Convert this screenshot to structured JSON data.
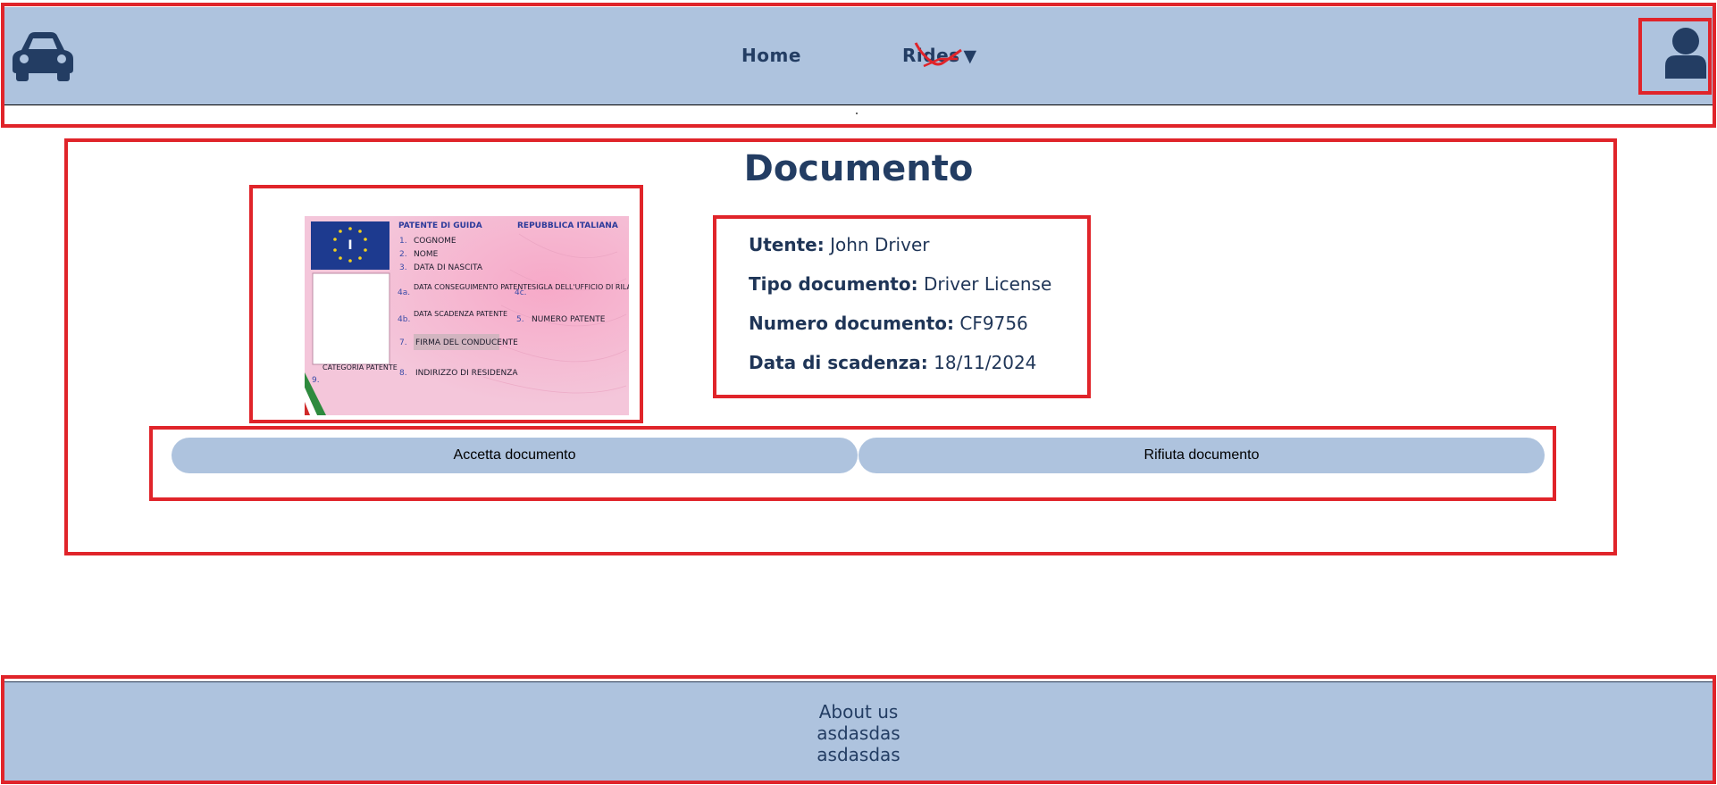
{
  "nav": {
    "home_label": "Home",
    "rides_label": "Rides",
    "rides_arrow": "▼",
    "logo_icon": "car-icon",
    "user_icon": "user-icon"
  },
  "page": {
    "title": "Documento"
  },
  "license_card": {
    "header_left": "PATENTE DI GUIDA",
    "header_right": "REPUBBLICA ITALIANA",
    "flag_letter": "I",
    "fields": [
      {
        "num": "1.",
        "text": "COGNOME"
      },
      {
        "num": "2.",
        "text": "NOME"
      },
      {
        "num": "3.",
        "text": "DATA DI NASCITA"
      },
      {
        "num": "4a.",
        "text": "DATA CONSEGUIMENTO PATENTE"
      },
      {
        "num": "4b.",
        "text": "DATA SCADENZA PATENTE"
      },
      {
        "num": "7.",
        "text": "FIRMA DEL CONDUCENTE"
      },
      {
        "num": "8.",
        "text": "INDIRIZZO DI RESIDENZA"
      },
      {
        "num": "4c.",
        "text": "SIGLA DELL'UFFICIO DI RILASCIO"
      },
      {
        "num": "5.",
        "text": "NUMERO PATENTE"
      },
      {
        "num": "9.",
        "text": "CATEGORIA PATENTE"
      }
    ]
  },
  "document_info": {
    "user_label": "Utente:",
    "user_value": "John Driver",
    "type_label": "Tipo documento:",
    "type_value": "Driver License",
    "number_label": "Numero documento:",
    "number_value": "CF9756",
    "expiry_label": "Data di scadenza:",
    "expiry_value": "18/11/2024"
  },
  "actions": {
    "accept_label": "Accetta documento",
    "reject_label": "Rifiuta documento"
  },
  "footer": {
    "line1": "About us",
    "line2": "asdasdas",
    "line3": "asdasdas"
  },
  "colors": {
    "nav_bg": "#aec3de",
    "text": "#233d63",
    "highlight": "#e0242a",
    "card_pink": "#f4c6da"
  }
}
